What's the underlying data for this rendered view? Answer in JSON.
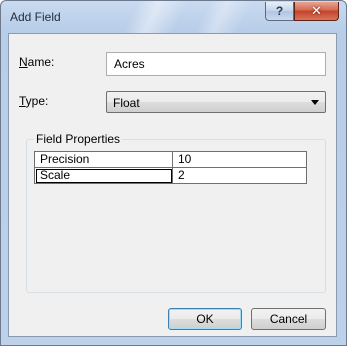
{
  "window": {
    "title": "Add Field",
    "help_glyph": "?",
    "close_glyph": "✕"
  },
  "form": {
    "name_label_accel": "N",
    "name_label_rest": "ame:",
    "name_value": "Acres",
    "type_label_accel": "T",
    "type_label_rest": "ype:",
    "type_value": "Float"
  },
  "field_properties": {
    "title": "Field Properties",
    "rows": [
      {
        "key": "Precision",
        "value": "10"
      },
      {
        "key": "Scale",
        "value": "2"
      }
    ]
  },
  "buttons": {
    "ok": "OK",
    "cancel": "Cancel"
  }
}
